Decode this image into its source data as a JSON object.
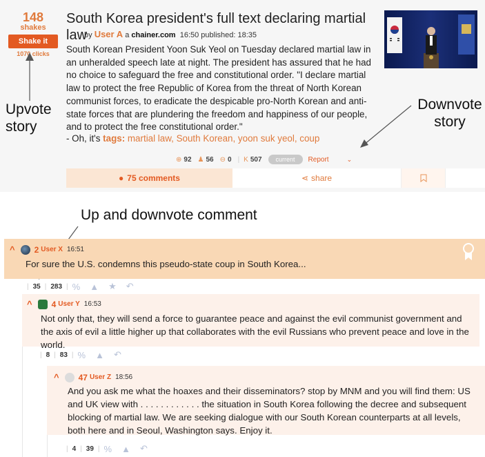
{
  "story": {
    "shakes_count": "148",
    "shakes_label": "shakes",
    "shake_button": "Shake it",
    "clicks": "1070 clicks",
    "title": "South Korea president's full text declaring martial law",
    "by": "by",
    "author": "User A",
    "a": "a",
    "domain": "chainer.com",
    "times": "16:50 published: 18:35",
    "body": "South Korean President Yoon Suk Yeol on Tuesday declared martial law in an unheralded speech late at night. The president has assured that he had no choice to safeguard the free and constitutional order. \"I declare martial law to protect the free Republic of Korea from the threat of North Korean communist forces, to eradicate the despicable pro-North Korean and anti-state forces that are plundering the freedom and happiness of our people, and to protect the free constitutional order.\"",
    "tags_prefix": "- Oh, it's",
    "tags_label": "tags:",
    "tags": "martial law, South Korean, yoon suk yeol, coup",
    "stats": {
      "positive": "92",
      "anonymous": "56",
      "negative": "0",
      "karma_label": "K",
      "karma": "507"
    },
    "status_badge": "current",
    "report_label": "Report",
    "comments_label": "75 comments",
    "share_label": "share"
  },
  "annotations": {
    "upvote_story": "Upvote\nstory",
    "downvote_story": "Downvote\nstory",
    "comment_votes": "Up and downvote comment"
  },
  "comments": [
    {
      "number": "2",
      "user": "User X",
      "time": "16:51",
      "text": "For sure the U.S. condemns this pseudo-state coup in South Korea...",
      "votes": "35",
      "karma": "283"
    },
    {
      "number": "4",
      "user": "User Y",
      "time": "16:53",
      "text": "Not only that, they will send a force to guarantee peace and against the evil communist government and the axis of evil a little higher up that collaborates with the evil Russians who prevent peace and love in the world.",
      "votes": "8",
      "karma": "83"
    },
    {
      "number": "47",
      "user": "User Z",
      "time": "18:56",
      "text": "And you ask me what the hoaxes and their disseminators? stop by MNM and you will find them: US and UK view with . . . . . . . . . . . . the situation in South Korea following the decree and subsequent blocking of martial law. We are seeking dialogue with our South Korean counterparts at all levels, both here and in Seoul, Washington says. Enjoy it.",
      "votes": "4",
      "karma": "39"
    }
  ],
  "colors": {
    "accent": "#e35a22",
    "accent_light": "#f9d8b5",
    "accent_soft": "#fdf1ea"
  }
}
